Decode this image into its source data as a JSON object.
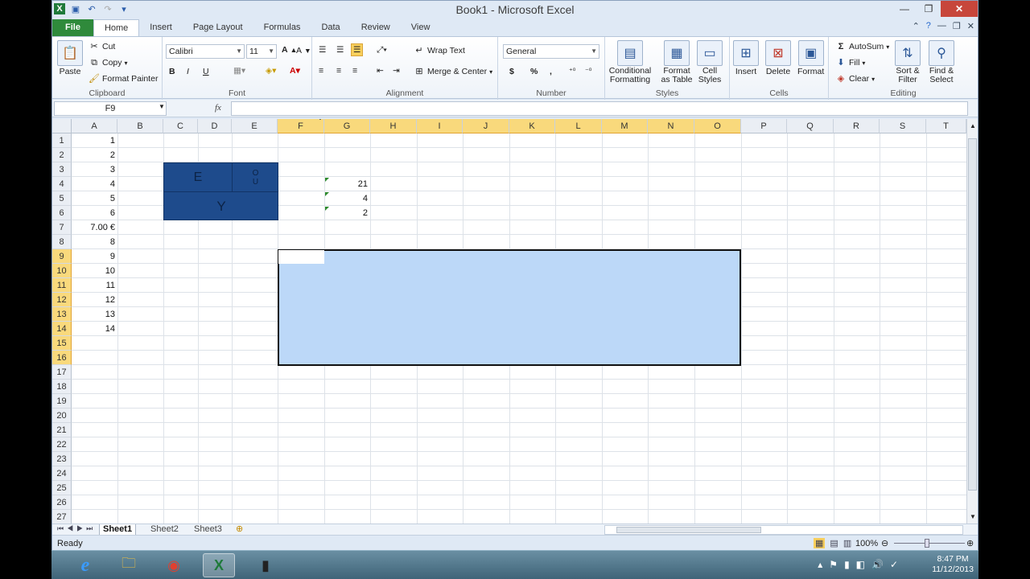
{
  "window": {
    "title": "Book1 - Microsoft Excel",
    "minimize": "—",
    "restore": "❐",
    "close": "✕"
  },
  "ribbon_tabs": [
    "File",
    "Home",
    "Insert",
    "Page Layout",
    "Formulas",
    "Data",
    "Review",
    "View"
  ],
  "clipboard": {
    "paste": "Paste",
    "cut": "Cut",
    "copy": "Copy",
    "format_painter": "Format Painter",
    "label": "Clipboard"
  },
  "font": {
    "name": "Calibri",
    "size": "11",
    "bold": "B",
    "italic": "I",
    "underline": "U",
    "label": "Font"
  },
  "alignment": {
    "wrap": "Wrap Text",
    "merge": "Merge & Center",
    "label": "Alignment"
  },
  "number": {
    "format": "General",
    "currency": "$",
    "percent": "%",
    "comma": ",",
    "label": "Number"
  },
  "styles": {
    "conditional": "Conditional Formatting",
    "format_table": "Format as Table",
    "cell_styles": "Cell Styles",
    "label": "Styles"
  },
  "cells": {
    "insert": "Insert",
    "delete": "Delete",
    "format": "Format",
    "label": "Cells"
  },
  "editing": {
    "autosum": "AutoSum",
    "fill": "Fill",
    "clear": "Clear",
    "sort": "Sort & Filter",
    "find": "Find & Select",
    "label": "Editing"
  },
  "formula_bar": {
    "name_box": "F9",
    "fx": "fx",
    "value": ""
  },
  "columns": [
    "A",
    "B",
    "C",
    "D",
    "E",
    "F",
    "G",
    "H",
    "I",
    "J",
    "K",
    "L",
    "M",
    "N",
    "O",
    "P",
    "Q",
    "R",
    "S",
    "T"
  ],
  "rows": [
    "1",
    "2",
    "3",
    "4",
    "5",
    "6",
    "7",
    "8",
    "9",
    "10",
    "11",
    "12",
    "13",
    "14",
    "15",
    "16",
    "17",
    "18",
    "19",
    "20",
    "21",
    "22",
    "23",
    "24",
    "25",
    "26",
    "27"
  ],
  "colA_values": [
    "1",
    "2",
    "3",
    "4",
    "5",
    "6",
    "7.00  €",
    "8",
    "9",
    "10",
    "11",
    "12",
    "13",
    "14"
  ],
  "colG_values": [
    "21",
    "4",
    "2"
  ],
  "merged_box": {
    "e": "E",
    "o": "O",
    "u": "U",
    "y": "Y"
  },
  "sheets": [
    "Sheet1",
    "Sheet2",
    "Sheet3"
  ],
  "status": {
    "ready": "Ready",
    "zoom": "100%"
  },
  "clock": {
    "time": "8:47 PM",
    "date": "11/12/2013"
  },
  "colors": {
    "accent": "#2f8a3b",
    "selection": "#bcd8f8",
    "box": "#1e4b8c",
    "header_sel": "#f9d97c"
  }
}
